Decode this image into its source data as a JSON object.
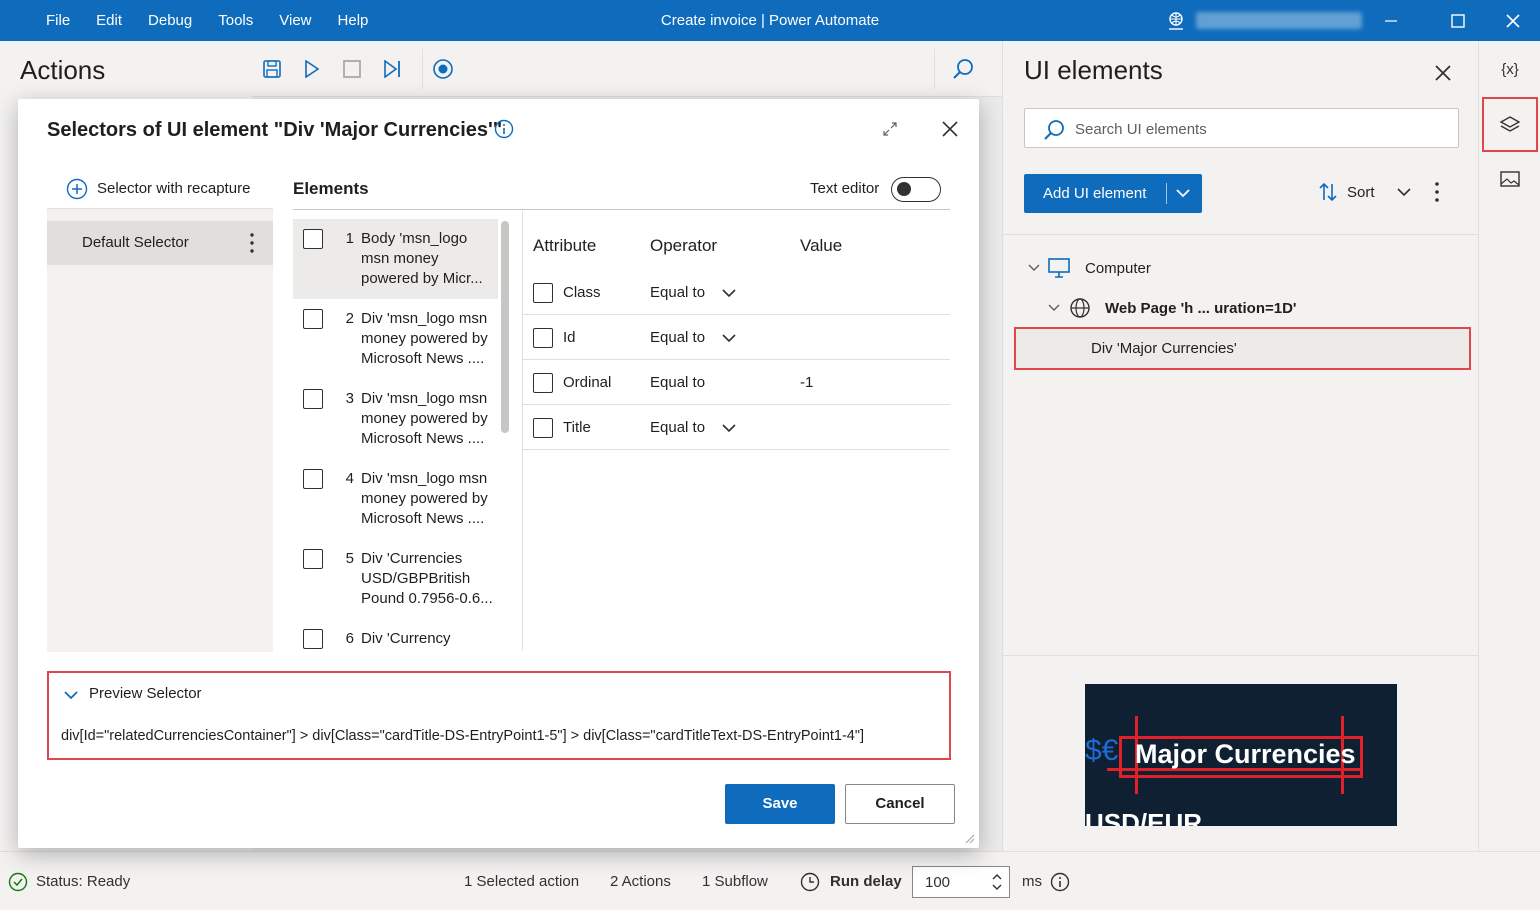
{
  "window": {
    "title": "Create invoice | Power Automate",
    "menu": [
      "File",
      "Edit",
      "Debug",
      "Tools",
      "View",
      "Help"
    ]
  },
  "actions_pane": {
    "title": "Actions"
  },
  "ui_elements_pane": {
    "title": "UI elements",
    "search_placeholder": "Search UI elements",
    "add_button": "Add UI element",
    "sort_label": "Sort",
    "tree": {
      "computer": "Computer",
      "web_page": "Web Page 'h ... uration=1D'",
      "selected_element": "Div 'Major Currencies'"
    },
    "thumbnail": {
      "text": "Major Currencies",
      "symbol": "$€",
      "below_text": "USD/EUR"
    }
  },
  "rail": {
    "variables_label": "{x}"
  },
  "dialog": {
    "title": "Selectors of UI element \"Div 'Major Currencies'\"",
    "selector_with_recapture": "Selector with recapture",
    "default_selector": "Default Selector",
    "elements_header": "Elements",
    "text_editor_label": "Text editor",
    "elements": [
      {
        "num": "1",
        "text": "Body 'msn_logo msn money powered by Micr..."
      },
      {
        "num": "2",
        "text": "Div 'msn_logo msn money powered by Microsoft News ...."
      },
      {
        "num": "3",
        "text": "Div 'msn_logo msn money powered by Microsoft News ...."
      },
      {
        "num": "4",
        "text": "Div 'msn_logo msn money powered by Microsoft News ...."
      },
      {
        "num": "5",
        "text": "Div 'Currencies USD/GBPBritish Pound 0.7956-0.6..."
      },
      {
        "num": "6",
        "text": "Div 'Currency"
      }
    ],
    "attr_headers": {
      "attribute": "Attribute",
      "operator": "Operator",
      "value": "Value"
    },
    "attributes": [
      {
        "name": "Class",
        "operator": "Equal to",
        "value": ""
      },
      {
        "name": "Id",
        "operator": "Equal to",
        "value": ""
      },
      {
        "name": "Ordinal",
        "operator": "Equal to",
        "value": "-1"
      },
      {
        "name": "Title",
        "operator": "Equal to",
        "value": ""
      }
    ],
    "preview_title": "Preview Selector",
    "preview_text": "div[Id=\"relatedCurrenciesContainer\"] > div[Class=\"cardTitle-DS-EntryPoint1-5\"] > div[Class=\"cardTitleText-DS-EntryPoint1-4\"]",
    "save": "Save",
    "cancel": "Cancel"
  },
  "status_bar": {
    "status": "Status: Ready",
    "selected_action": "1 Selected action",
    "actions": "2 Actions",
    "subflow": "1 Subflow",
    "run_delay_label": "Run delay",
    "run_delay_value": "100",
    "unit": "ms"
  },
  "colors": {
    "accent": "#0f6cbd",
    "highlight": "#e0474c"
  }
}
